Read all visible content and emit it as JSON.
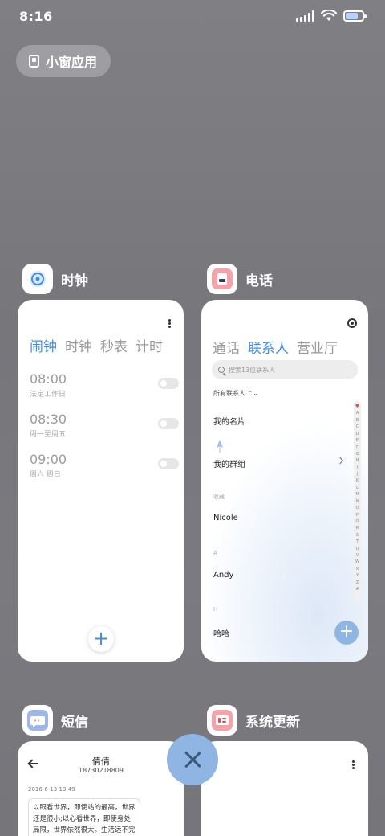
{
  "status_bar": {
    "time": "8:16"
  },
  "small_window_button": {
    "label": "小窗应用"
  },
  "apps": {
    "clock": {
      "name": "时钟",
      "tabs": [
        "闹钟",
        "时钟",
        "秒表",
        "计时"
      ],
      "alarms": [
        {
          "time": "08:00",
          "repeat": "法定工作日"
        },
        {
          "time": "08:30",
          "repeat": "周一至周五"
        },
        {
          "time": "09:00",
          "repeat": "周六 周日"
        }
      ],
      "add_symbol": "+"
    },
    "phone": {
      "name": "电话",
      "tabs": [
        "通话",
        "联系人",
        "营业厅"
      ],
      "search_placeholder": "搜索13位联系人",
      "filter": "所有联系人 ⌃⌄",
      "my_card": "我的名片",
      "my_groups": "我的群组",
      "sections": [
        {
          "letter": "收藏",
          "name": "Nicole"
        },
        {
          "letter": "A",
          "name": "Andy"
        },
        {
          "letter": "H",
          "name": "哈哈"
        }
      ],
      "index_letters": [
        "♥",
        "A",
        "B",
        "C",
        "D",
        "E",
        "F",
        "G",
        "H",
        "I",
        "J",
        "K",
        "L",
        "M",
        "N",
        "O",
        "P",
        "Q",
        "R",
        "S",
        "T",
        "U",
        "V",
        "W",
        "X",
        "Y",
        "Z",
        "#"
      ],
      "add_symbol": "+"
    },
    "messages": {
      "name": "短信",
      "contact_name": "倩倩",
      "contact_number": "18730218809",
      "date": "2016-6-13 13:49",
      "message_text": "以眼看世界，即使站的最高，世界还是很小;以心看世界，即使身处局限，世界依然很大。生活远不完美，但眼界决定境界，心宽才能路宽。"
    },
    "system_update": {
      "name": "系统更新"
    }
  },
  "colors": {
    "accent": "#3d8de6",
    "fab": "#8fb5e2",
    "background": "#7b7b80"
  }
}
